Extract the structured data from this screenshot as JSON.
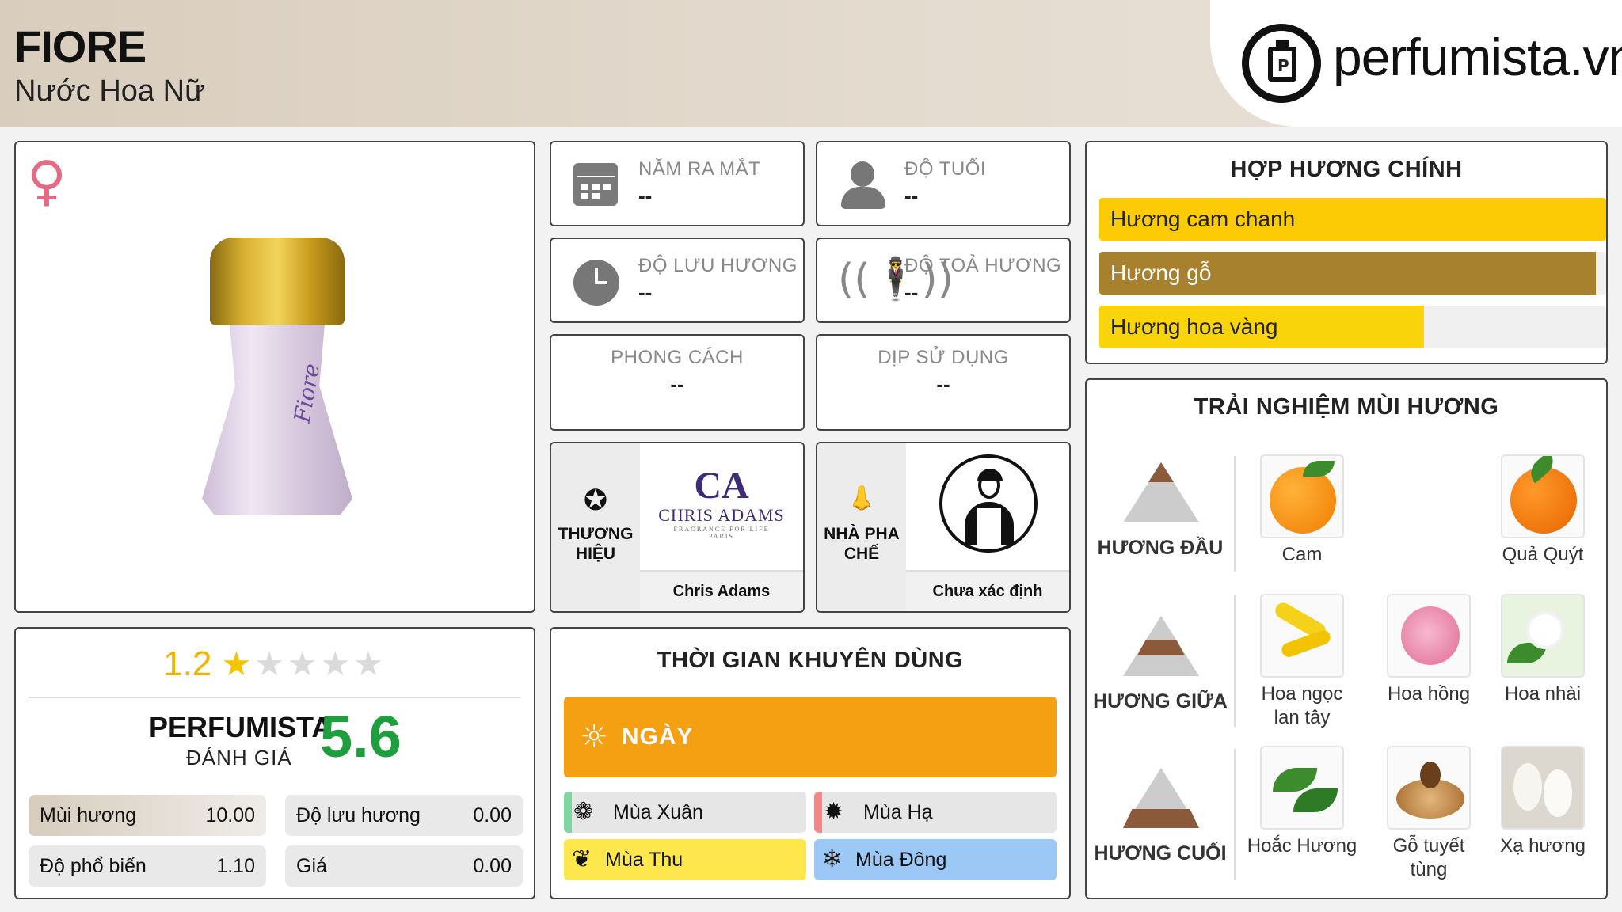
{
  "header": {
    "title": "FIORE",
    "subtitle": "Nước Hoa Nữ",
    "logo_text": "perfumista.vn"
  },
  "product": {
    "gender_icon": "female-symbol-icon",
    "bottle_label": "Fiore"
  },
  "rating": {
    "score": "1.2",
    "stars_on": 1,
    "stars_total": 5,
    "pf_name": "PERFUMISTA",
    "pf_sub": "ĐÁNH GIÁ",
    "pf_score": "5.6",
    "metrics": [
      {
        "label": "Mùi hương",
        "value": "10.00"
      },
      {
        "label": "Độ lưu hương",
        "value": "0.00"
      },
      {
        "label": "Độ phổ biến",
        "value": "1.10"
      },
      {
        "label": "Giá",
        "value": "0.00"
      }
    ]
  },
  "info": {
    "launch": {
      "label": "NĂM RA MẮT",
      "value": "--",
      "icon": "calendar-icon"
    },
    "age": {
      "label": "ĐỘ TUỔI",
      "value": "--",
      "icon": "person-icon"
    },
    "longevity": {
      "label": "ĐỘ LƯU HƯƠNG",
      "value": "--",
      "icon": "clock-icon"
    },
    "sillage": {
      "label": "ĐỘ TOẢ HƯƠNG",
      "value": "--",
      "icon": "radiate-icon"
    },
    "style": {
      "label": "PHONG CÁCH",
      "value": "--"
    },
    "occasion": {
      "label": "DỊP SỬ DỤNG",
      "value": "--"
    }
  },
  "brand": {
    "label": "THƯƠNG HIỆU",
    "name": "Chris Adams",
    "logo_mono": "CA",
    "logo_name": "CHRIS ADAMS",
    "logo_tag": "FRAGRANCE FOR LIFE",
    "logo_city": "PARIS",
    "icon": "star-badge-icon"
  },
  "perfumer": {
    "label": "NHÀ PHA CHẾ",
    "name": "Chưa xác định",
    "icon": "nose-icon"
  },
  "time": {
    "title": "THỜI GIAN KHUYÊN DÙNG",
    "day_label": "NGÀY",
    "seasons": [
      {
        "label": "Mùa Xuân",
        "color": "#e6e6e6",
        "accent": "#7fd6a0"
      },
      {
        "label": "Mùa Hạ",
        "color": "#e6e6e6",
        "accent": "#f08a8a"
      },
      {
        "label": "Mùa Thu",
        "color": "#fde74c",
        "accent": "#fde74c"
      },
      {
        "label": "Mùa Đông",
        "color": "#9cc8f5",
        "accent": "#9cc8f5"
      }
    ]
  },
  "accords": {
    "title": "HỢP HƯƠNG CHÍNH",
    "items": [
      {
        "label": "Hương cam chanh",
        "fraction": 1.0,
        "color": "#fccb06"
      },
      {
        "label": "Hương gỗ",
        "fraction": 0.98,
        "color": "#a8812f"
      },
      {
        "label": "Hương hoa vàng",
        "fraction": 0.64,
        "color": "#fad40a"
      }
    ]
  },
  "notes": {
    "title": "TRẢI NGHIỆM MÙI HƯƠNG",
    "top": {
      "label": "HƯƠNG ĐẦU",
      "items": [
        "Cam",
        "Quả Quýt"
      ]
    },
    "middle": {
      "label": "HƯƠNG GIỮA",
      "items": [
        "Hoa ngọc lan tây",
        "Hoa hồng",
        "Hoa nhài"
      ]
    },
    "base": {
      "label": "HƯƠNG CUỐI",
      "items": [
        "Hoắc Hương",
        "Gỗ tuyết tùng",
        "Xạ hương"
      ]
    }
  }
}
